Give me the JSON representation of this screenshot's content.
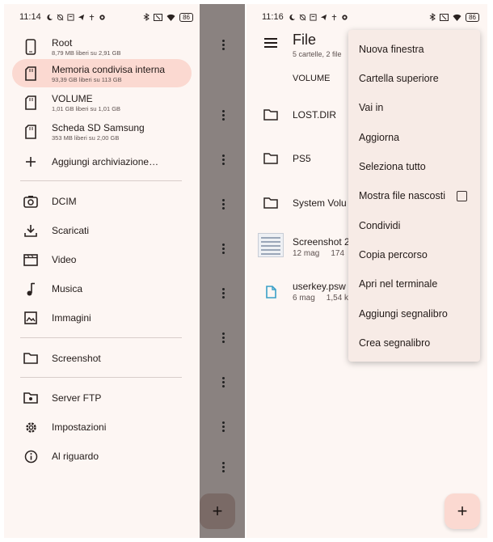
{
  "left": {
    "status": {
      "time": "11:14",
      "battery": "86"
    },
    "drawer": {
      "storage": [
        {
          "title": "Root",
          "subtitle": "8,79 MB liberi su 2,91 GB",
          "icon": "phone-icon",
          "selected": false
        },
        {
          "title": "Memoria condivisa interna",
          "subtitle": "93,39 GB liberi su 113 GB",
          "icon": "sd-card-icon",
          "selected": true
        },
        {
          "title": "VOLUME",
          "subtitle": "1,01 GB liberi su 1,01 GB",
          "icon": "sd-card-icon",
          "selected": false
        },
        {
          "title": "Scheda SD Samsung",
          "subtitle": "353 MB liberi su 2,00 GB",
          "icon": "sd-card-icon",
          "selected": false
        }
      ],
      "add_storage": "Aggiungi archiviazione…",
      "folders": [
        {
          "title": "DCIM",
          "icon": "camera-icon"
        },
        {
          "title": "Scaricati",
          "icon": "download-icon"
        },
        {
          "title": "Video",
          "icon": "video-icon"
        },
        {
          "title": "Musica",
          "icon": "music-note-icon"
        },
        {
          "title": "Immagini",
          "icon": "image-icon"
        }
      ],
      "bookmark": {
        "title": "Screenshot",
        "icon": "folder-icon"
      },
      "bottom": [
        {
          "title": "Server FTP",
          "icon": "ftp-server-icon"
        },
        {
          "title": "Impostazioni",
          "icon": "gear-icon"
        },
        {
          "title": "Al riguardo",
          "icon": "info-icon"
        }
      ]
    },
    "fab": "+"
  },
  "right": {
    "status": {
      "time": "11:16",
      "battery": "86"
    },
    "title": "File",
    "subtitle": "5 cartelle, 2 file",
    "breadcrumb": "VOLUME",
    "files": [
      {
        "name": "LOST.DIR",
        "icon": "folder-icon",
        "date": "",
        "size": ""
      },
      {
        "name": "PS5",
        "icon": "folder-icon",
        "date": "",
        "size": ""
      },
      {
        "name": "System Volu",
        "icon": "folder-icon",
        "date": "",
        "size": ""
      },
      {
        "name": "Screenshot 2",
        "icon": "image-thumbnail",
        "date": "12 mag",
        "size": "174"
      },
      {
        "name": "userkey.psw",
        "icon": "file-icon",
        "date": "6 mag",
        "size": "1,54 k"
      }
    ],
    "menu": [
      {
        "label": "Nuova finestra",
        "checkbox": false
      },
      {
        "label": "Cartella superiore",
        "checkbox": false
      },
      {
        "label": "Vai in",
        "checkbox": false
      },
      {
        "label": "Aggiorna",
        "checkbox": false
      },
      {
        "label": "Seleziona tutto",
        "checkbox": false
      },
      {
        "label": "Mostra file nascosti",
        "checkbox": true,
        "checked": false
      },
      {
        "label": "Condividi",
        "checkbox": false
      },
      {
        "label": "Copia percorso",
        "checkbox": false
      },
      {
        "label": "Apri nel terminale",
        "checkbox": false
      },
      {
        "label": "Aggiungi segnalibro",
        "checkbox": false
      },
      {
        "label": "Crea segnalibro",
        "checkbox": false
      }
    ],
    "fab": "+"
  },
  "colors": {
    "selected_bg": "#fbd9d1",
    "surface": "#fdf6f3",
    "menu_bg": "#f7ebe6",
    "scrim": "#8a8280",
    "accent_file": "#3aa0c8"
  }
}
